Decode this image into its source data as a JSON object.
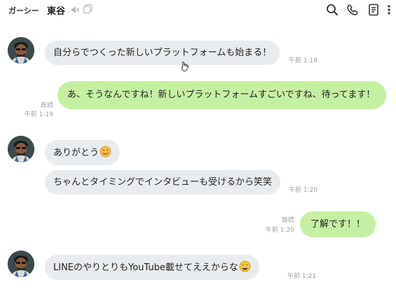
{
  "header": {
    "chat_label": "ガーシー",
    "name": "東谷",
    "icons": [
      "mute-icon",
      "copy-icon",
      "search-icon",
      "phone-icon",
      "notes-icon",
      "more-icon"
    ]
  },
  "colors": {
    "incoming_bubble": "#e9ecee",
    "outgoing_bubble": "#c6f0a1",
    "meta_text": "#9aa0a6"
  },
  "messages": [
    {
      "from": "other",
      "text": "自分らでつくった新しいプラットフォームも始まる！",
      "time": "午前 1:18"
    },
    {
      "from": "me",
      "text": "あ、そうなんですね！新しいプラットフォームすごいですね、待ってます！",
      "read": "既読",
      "time": "午前 1:19"
    },
    {
      "from": "other",
      "text": "ありがとう",
      "emoji": "smiling-face-emoji"
    },
    {
      "from": "other",
      "text": "ちゃんとタイミングでインタビューも受けるから笑笑",
      "time": "午前 1:20"
    },
    {
      "from": "me",
      "text": "了解です！！",
      "read": "既読",
      "time": "午前 1:20"
    },
    {
      "from": "other",
      "text": "LINEのやりとりもYouTube載せてええからな",
      "emoji": "grinning-face-emoji",
      "time": "午前 1:21"
    }
  ]
}
